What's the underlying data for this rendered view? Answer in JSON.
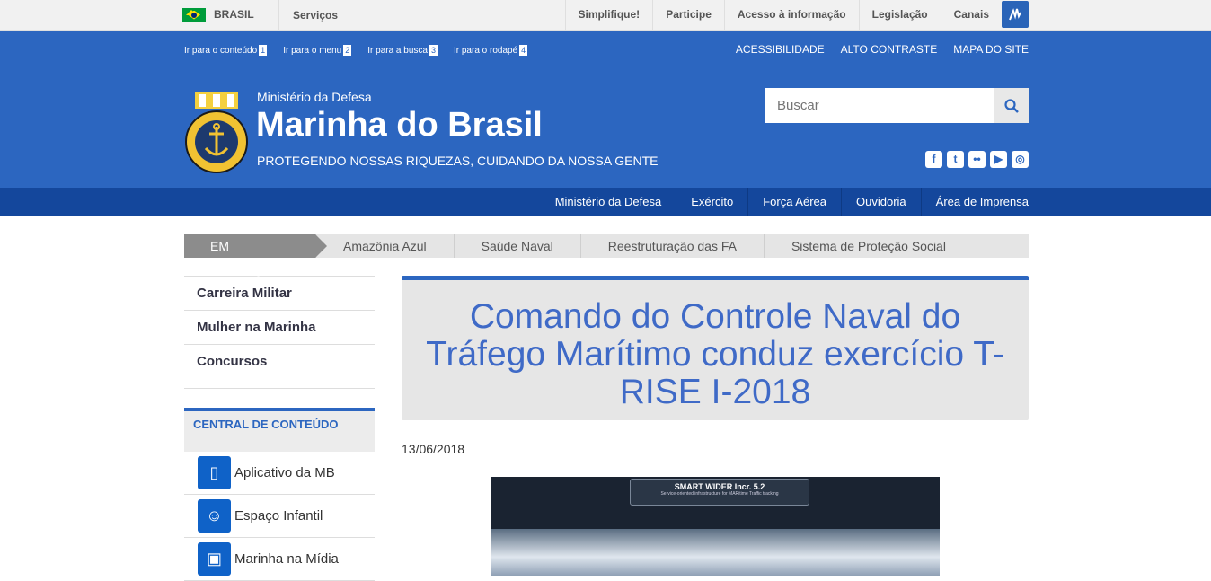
{
  "govbar": {
    "brasil": "BRASIL",
    "servicos": "Serviços",
    "links": [
      "Simplifique!",
      "Participe",
      "Acesso à informação",
      "Legislação",
      "Canais"
    ]
  },
  "access": {
    "shortcuts": [
      {
        "label": "Ir para o conteúdo",
        "key": "1"
      },
      {
        "label": "Ir para o menu",
        "key": "2"
      },
      {
        "label": "Ir para a busca",
        "key": "3"
      },
      {
        "label": "Ir para o rodapé",
        "key": "4"
      }
    ],
    "links": [
      "ACESSIBILIDADE",
      "ALTO CONTRASTE",
      "MAPA DO SITE"
    ]
  },
  "header": {
    "ministry": "Ministério da Defesa",
    "site_name": "Marinha do Brasil",
    "slogan": "PROTEGENDO NOSSAS RIQUEZAS, CUIDANDO DA NOSSA GENTE",
    "search_placeholder": "Buscar",
    "social_icons": [
      "facebook-icon",
      "twitter-icon",
      "flickr-icon",
      "youtube-icon",
      "instagram-icon"
    ]
  },
  "nav": [
    "Ministério da Defesa",
    "Exército",
    "Força Aérea",
    "Ouvidoria",
    "Área de Imprensa"
  ],
  "destaque": {
    "label": "EM DESTAQUE",
    "items": [
      "Amazônia Azul",
      "Saúde Naval",
      "Reestruturação das FA",
      "Sistema de Proteção Social"
    ]
  },
  "sidebar": {
    "menu": [
      "Carreira Militar",
      "Mulher na Marinha",
      "Concursos"
    ],
    "central_title": "CENTRAL DE CONTEÚDO",
    "central_items": [
      "Aplicativo da MB",
      "Espaço Infantil",
      "Marinha na Mídia"
    ]
  },
  "article": {
    "title": "Comando do Controle Naval do Tráfego Marítimo conduz exercício T-RISE I-2018",
    "date": "13/06/2018",
    "image_caption_title": "SMART WIDER Incr. 5.2",
    "image_caption_sub": "Service-oriented infrastructure for MARitime Traffic tracking"
  },
  "colors": {
    "brand_blue": "#2c66c0",
    "nav_blue": "#14479c",
    "title_blue": "#3f6ac7"
  }
}
